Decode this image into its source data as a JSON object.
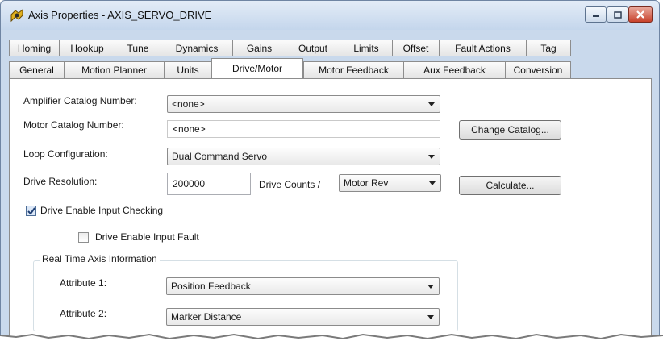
{
  "window": {
    "title": "Axis Properties - AXIS_SERVO_DRIVE",
    "icon": "axis-properties-icon",
    "controls": [
      "minimize-icon",
      "maximize-icon",
      "close-icon"
    ]
  },
  "tabs_row1": [
    "Homing",
    "Hookup",
    "Tune",
    "Dynamics",
    "Gains",
    "Output",
    "Limits",
    "Offset",
    "Fault Actions",
    "Tag"
  ],
  "tabs_row2": [
    "General",
    "Motion Planner",
    "Units",
    "Drive/Motor",
    "Motor Feedback",
    "Aux Feedback",
    "Conversion"
  ],
  "active_tab": "Drive/Motor",
  "form": {
    "amplifier_label": "Amplifier Catalog Number:",
    "amplifier_value": "<none>",
    "motor_label": "Motor Catalog Number:",
    "motor_value": "<none>",
    "change_catalog_button": "Change Catalog...",
    "loop_label": "Loop Configuration:",
    "loop_value": "Dual Command Servo",
    "resolution_label": "Drive Resolution:",
    "resolution_value": "200000",
    "drive_counts_label": "Drive Counts /",
    "per_unit_value": "Motor Rev",
    "calculate_button": "Calculate...",
    "enable_input_checking_label": "Drive Enable Input Checking",
    "enable_input_checking": true,
    "enable_input_fault_label": "Drive Enable Input Fault",
    "enable_input_fault": false
  },
  "realtime": {
    "title": "Real Time Axis Information",
    "attr1_label": "Attribute 1:",
    "attr1_value": "Position Feedback",
    "attr2_label": "Attribute 2:",
    "attr2_value": "Marker Distance"
  },
  "colors": {
    "frame": "#c9d9ec",
    "close_button": "#c8412b",
    "checkbox_check": "#1f3f73"
  }
}
